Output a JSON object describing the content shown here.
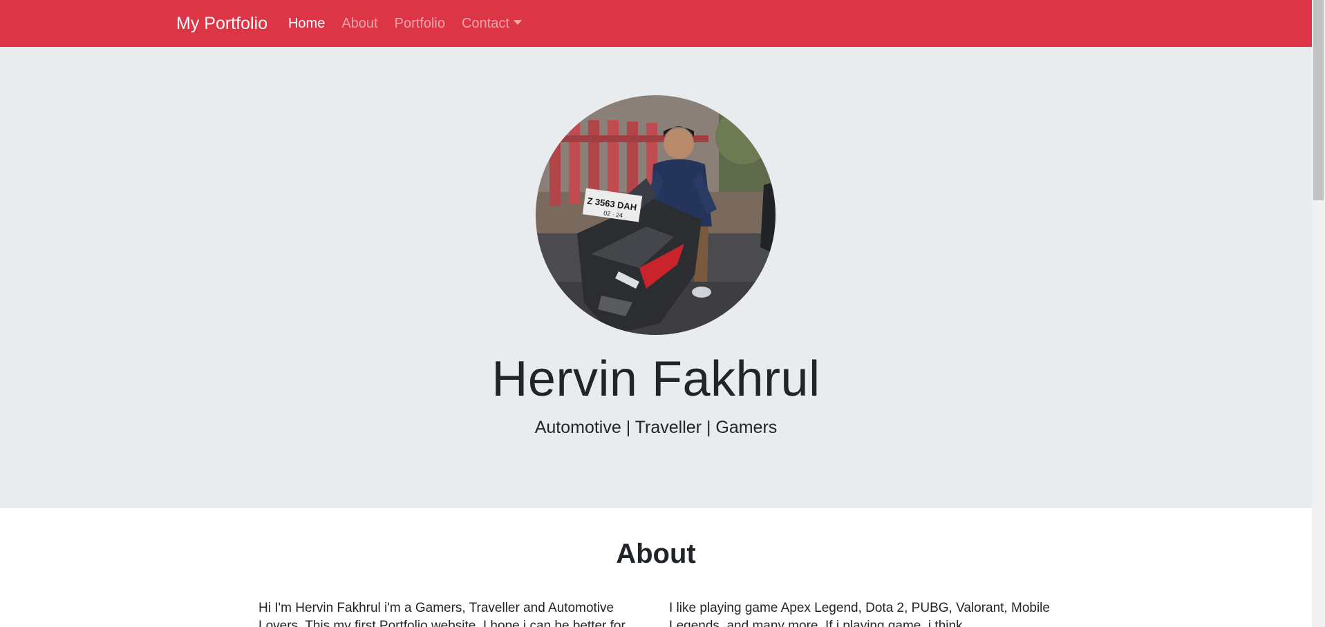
{
  "navbar": {
    "brand": "My Portfolio",
    "links": [
      {
        "label": "Home",
        "active": true
      },
      {
        "label": "About",
        "active": false
      },
      {
        "label": "Portfolio",
        "active": false
      },
      {
        "label": "Contact",
        "active": false,
        "dropdown": true
      }
    ],
    "color": "#dc3545"
  },
  "hero": {
    "name": "Hervin Fakhrul",
    "tagline": "Automotive | Traveller | Gamers",
    "avatar_alt_icon": "profile-photo",
    "plate_text": "Z 3563 DAH",
    "plate_sub": "02 · 24",
    "background": "#e9ecef"
  },
  "about": {
    "title": "About",
    "left_text": "Hi I'm Hervin Fakhrul i'm a Gamers, Traveller and Automotive Lovers. This my first Portfolio website, I hope i can be better for",
    "right_text": "I like playing game Apex Legend, Dota 2, PUBG, Valorant, Mobile Legends, and many more. If i playing game, i think"
  }
}
